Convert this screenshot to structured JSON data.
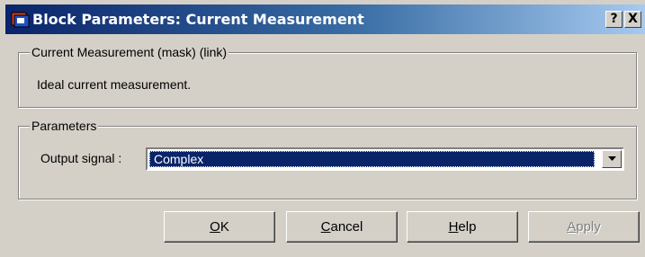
{
  "window": {
    "title": "Block Parameters: Current Measurement",
    "help_button": "?",
    "close_button": "X"
  },
  "description_group": {
    "legend": "Current Measurement (mask) (link)",
    "text": "Ideal current measurement."
  },
  "parameters_group": {
    "legend": "Parameters",
    "output_signal_label": "Output signal :",
    "output_signal_value": "Complex"
  },
  "buttons": {
    "ok": {
      "accel": "O",
      "rest": "K"
    },
    "cancel": {
      "accel": "C",
      "rest": "ancel"
    },
    "help": {
      "accel": "H",
      "rest": "elp"
    },
    "apply": {
      "accel": "A",
      "rest": "pply",
      "enabled": false
    }
  },
  "colors": {
    "titlebar_start": "#0a246a",
    "titlebar_end": "#a6caf0",
    "face": "#d4d0c8",
    "selection": "#0a246a"
  },
  "icons": [
    "simulink-block-icon",
    "help-icon",
    "close-icon",
    "dropdown-arrow-icon"
  ]
}
